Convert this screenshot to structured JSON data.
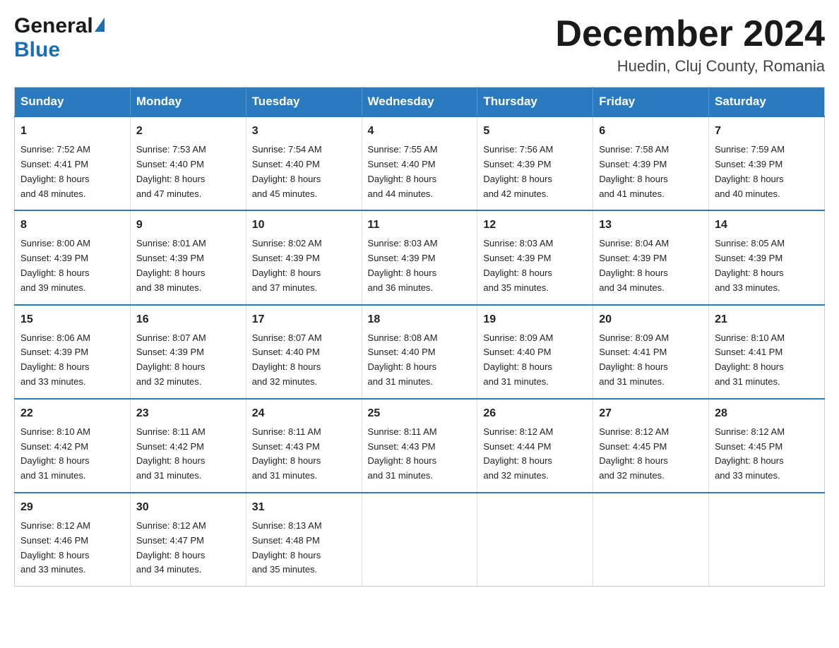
{
  "header": {
    "logo_general": "General",
    "logo_blue": "Blue",
    "month_year": "December 2024",
    "location": "Huedin, Cluj County, Romania"
  },
  "columns": [
    "Sunday",
    "Monday",
    "Tuesday",
    "Wednesday",
    "Thursday",
    "Friday",
    "Saturday"
  ],
  "weeks": [
    [
      {
        "day": "1",
        "sunrise": "7:52 AM",
        "sunset": "4:41 PM",
        "daylight": "8 hours and 48 minutes."
      },
      {
        "day": "2",
        "sunrise": "7:53 AM",
        "sunset": "4:40 PM",
        "daylight": "8 hours and 47 minutes."
      },
      {
        "day": "3",
        "sunrise": "7:54 AM",
        "sunset": "4:40 PM",
        "daylight": "8 hours and 45 minutes."
      },
      {
        "day": "4",
        "sunrise": "7:55 AM",
        "sunset": "4:40 PM",
        "daylight": "8 hours and 44 minutes."
      },
      {
        "day": "5",
        "sunrise": "7:56 AM",
        "sunset": "4:39 PM",
        "daylight": "8 hours and 42 minutes."
      },
      {
        "day": "6",
        "sunrise": "7:58 AM",
        "sunset": "4:39 PM",
        "daylight": "8 hours and 41 minutes."
      },
      {
        "day": "7",
        "sunrise": "7:59 AM",
        "sunset": "4:39 PM",
        "daylight": "8 hours and 40 minutes."
      }
    ],
    [
      {
        "day": "8",
        "sunrise": "8:00 AM",
        "sunset": "4:39 PM",
        "daylight": "8 hours and 39 minutes."
      },
      {
        "day": "9",
        "sunrise": "8:01 AM",
        "sunset": "4:39 PM",
        "daylight": "8 hours and 38 minutes."
      },
      {
        "day": "10",
        "sunrise": "8:02 AM",
        "sunset": "4:39 PM",
        "daylight": "8 hours and 37 minutes."
      },
      {
        "day": "11",
        "sunrise": "8:03 AM",
        "sunset": "4:39 PM",
        "daylight": "8 hours and 36 minutes."
      },
      {
        "day": "12",
        "sunrise": "8:03 AM",
        "sunset": "4:39 PM",
        "daylight": "8 hours and 35 minutes."
      },
      {
        "day": "13",
        "sunrise": "8:04 AM",
        "sunset": "4:39 PM",
        "daylight": "8 hours and 34 minutes."
      },
      {
        "day": "14",
        "sunrise": "8:05 AM",
        "sunset": "4:39 PM",
        "daylight": "8 hours and 33 minutes."
      }
    ],
    [
      {
        "day": "15",
        "sunrise": "8:06 AM",
        "sunset": "4:39 PM",
        "daylight": "8 hours and 33 minutes."
      },
      {
        "day": "16",
        "sunrise": "8:07 AM",
        "sunset": "4:39 PM",
        "daylight": "8 hours and 32 minutes."
      },
      {
        "day": "17",
        "sunrise": "8:07 AM",
        "sunset": "4:40 PM",
        "daylight": "8 hours and 32 minutes."
      },
      {
        "day": "18",
        "sunrise": "8:08 AM",
        "sunset": "4:40 PM",
        "daylight": "8 hours and 31 minutes."
      },
      {
        "day": "19",
        "sunrise": "8:09 AM",
        "sunset": "4:40 PM",
        "daylight": "8 hours and 31 minutes."
      },
      {
        "day": "20",
        "sunrise": "8:09 AM",
        "sunset": "4:41 PM",
        "daylight": "8 hours and 31 minutes."
      },
      {
        "day": "21",
        "sunrise": "8:10 AM",
        "sunset": "4:41 PM",
        "daylight": "8 hours and 31 minutes."
      }
    ],
    [
      {
        "day": "22",
        "sunrise": "8:10 AM",
        "sunset": "4:42 PM",
        "daylight": "8 hours and 31 minutes."
      },
      {
        "day": "23",
        "sunrise": "8:11 AM",
        "sunset": "4:42 PM",
        "daylight": "8 hours and 31 minutes."
      },
      {
        "day": "24",
        "sunrise": "8:11 AM",
        "sunset": "4:43 PM",
        "daylight": "8 hours and 31 minutes."
      },
      {
        "day": "25",
        "sunrise": "8:11 AM",
        "sunset": "4:43 PM",
        "daylight": "8 hours and 31 minutes."
      },
      {
        "day": "26",
        "sunrise": "8:12 AM",
        "sunset": "4:44 PM",
        "daylight": "8 hours and 32 minutes."
      },
      {
        "day": "27",
        "sunrise": "8:12 AM",
        "sunset": "4:45 PM",
        "daylight": "8 hours and 32 minutes."
      },
      {
        "day": "28",
        "sunrise": "8:12 AM",
        "sunset": "4:45 PM",
        "daylight": "8 hours and 33 minutes."
      }
    ],
    [
      {
        "day": "29",
        "sunrise": "8:12 AM",
        "sunset": "4:46 PM",
        "daylight": "8 hours and 33 minutes."
      },
      {
        "day": "30",
        "sunrise": "8:12 AM",
        "sunset": "4:47 PM",
        "daylight": "8 hours and 34 minutes."
      },
      {
        "day": "31",
        "sunrise": "8:13 AM",
        "sunset": "4:48 PM",
        "daylight": "8 hours and 35 minutes."
      },
      null,
      null,
      null,
      null
    ]
  ],
  "labels": {
    "sunrise": "Sunrise:",
    "sunset": "Sunset:",
    "daylight": "Daylight:"
  }
}
